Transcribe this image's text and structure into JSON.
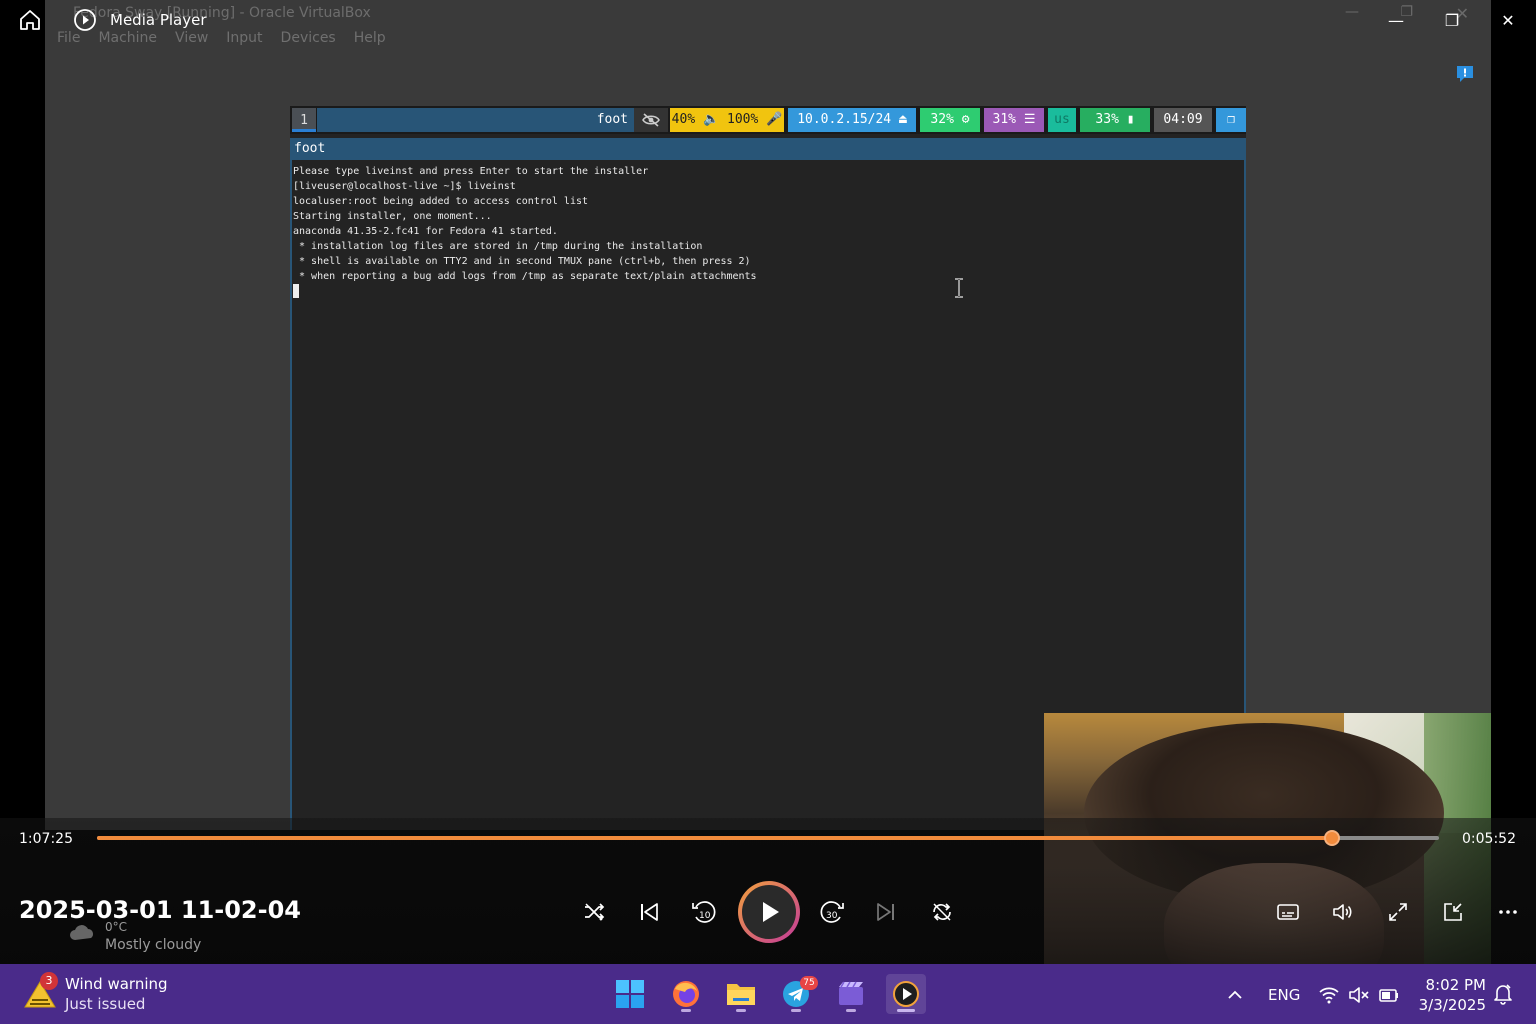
{
  "media_player": {
    "title": "Media Player",
    "window_controls": {
      "minimize": "—",
      "restore": "❐",
      "close": "✕"
    }
  },
  "vbox": {
    "title": "Fedora Sway [Running] - Oracle VirtualBox",
    "menus": [
      "File",
      "Machine",
      "View",
      "Input",
      "Devices",
      "Help"
    ]
  },
  "sway_bar": {
    "workspace": "1",
    "window_title": "foot",
    "audio": "40% 🔈 100% 🎤",
    "network": "10.0.2.15/24",
    "cpu": "32%",
    "memory": "31%",
    "keyboard": "us",
    "battery": "33%",
    "clock": "04:09"
  },
  "terminal": {
    "title": "foot",
    "lines": [
      "Please type liveinst and press Enter to start the installer",
      "[liveuser@localhost-live ~]$ liveinst",
      "localuser:root being added to access control list",
      "Starting installer, one moment...",
      "anaconda 41.35-2.fc41 for Fedora 41 started.",
      " * installation log files are stored in /tmp during the installation",
      " * shell is available on TTY2 and in second TMUX pane (ctrl+b, then press 2)",
      " * when reporting a bug add logs from /tmp as separate text/plain attachments"
    ]
  },
  "player": {
    "elapsed": "1:07:25",
    "remaining": "0:05:52",
    "progress": 0.92,
    "video_name": "2025-03-01 11-02-04",
    "accent": "#f28b3c"
  },
  "ghost_weather": {
    "temp": "0°C",
    "condition": "Mostly cloudy"
  },
  "taskbar": {
    "widget": {
      "badge": "3",
      "title": "Wind warning",
      "subtitle": "Just issued"
    },
    "apps": [
      {
        "name": "start",
        "icon": "windows-logo-icon"
      },
      {
        "name": "firefox",
        "icon": "firefox-icon"
      },
      {
        "name": "file-explorer",
        "icon": "folder-icon"
      },
      {
        "name": "telegram",
        "icon": "telegram-icon",
        "badge": "75"
      },
      {
        "name": "clipchamp",
        "icon": "clipchamp-icon"
      },
      {
        "name": "media-player",
        "icon": "media-player-icon",
        "active": true
      }
    ],
    "language": "ENG",
    "time": "8:02 PM",
    "date": "3/3/2025"
  }
}
